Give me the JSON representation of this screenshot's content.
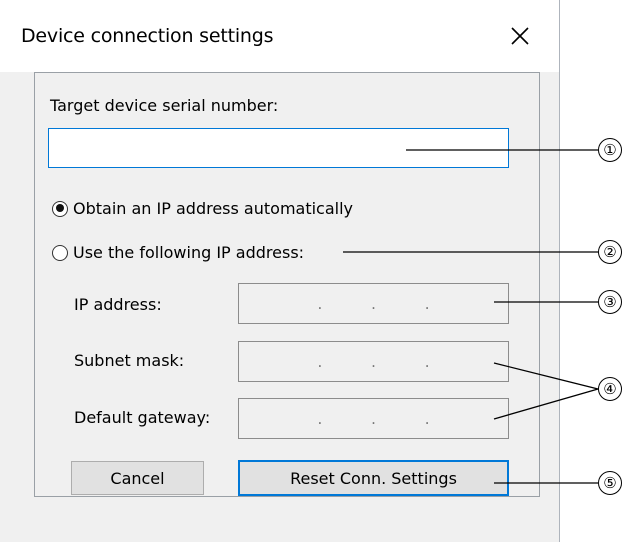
{
  "window": {
    "title": "Device connection settings",
    "close_icon": "close-icon"
  },
  "serial": {
    "label": "Target device serial number:",
    "value": ""
  },
  "radios": {
    "auto": {
      "label": "Obtain an IP address automatically",
      "checked": true
    },
    "manual": {
      "label": "Use the following IP address:",
      "checked": false
    }
  },
  "fields": {
    "ip": {
      "label": "IP address:",
      "dots": [
        ".",
        ".",
        "."
      ]
    },
    "subnet": {
      "label": "Subnet mask:",
      "dots": [
        ".",
        ".",
        "."
      ]
    },
    "gateway": {
      "label": "Default gateway:",
      "dots": [
        ".",
        ".",
        "."
      ]
    }
  },
  "buttons": {
    "cancel": "Cancel",
    "reset": "Reset Conn. Settings"
  },
  "callouts": [
    "①",
    "②",
    "③",
    "④",
    "⑤"
  ],
  "colors": {
    "accent": "#0078d7",
    "dialog_bg": "#f0f0f0",
    "button_bg": "#e1e1e1"
  }
}
